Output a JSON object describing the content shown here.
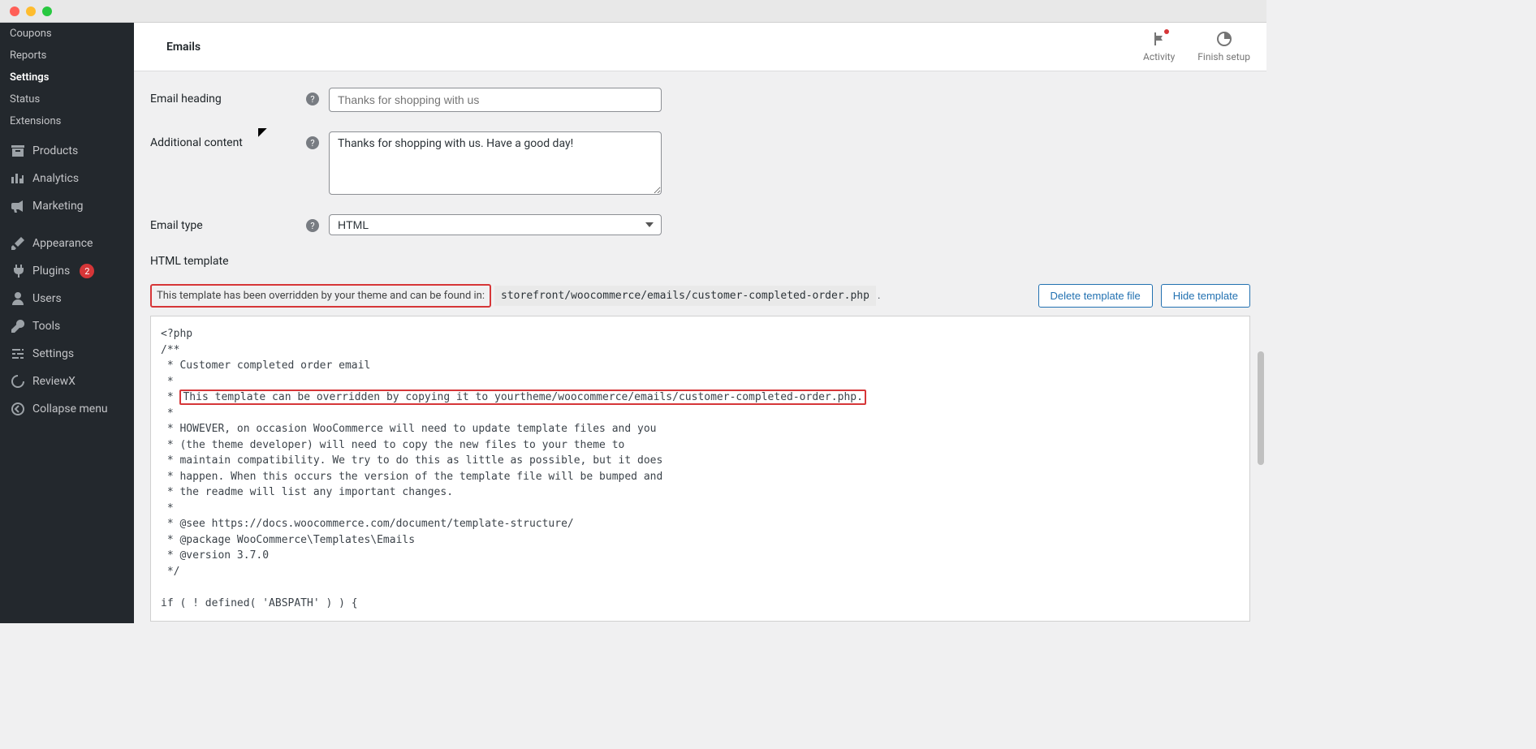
{
  "sidebar": {
    "sub_items": [
      "Coupons",
      "Reports",
      "Settings",
      "Status",
      "Extensions"
    ],
    "active_sub": "Settings",
    "items": [
      {
        "key": "products",
        "label": "Products",
        "icon": "archive"
      },
      {
        "key": "analytics",
        "label": "Analytics",
        "icon": "bars"
      },
      {
        "key": "marketing",
        "label": "Marketing",
        "icon": "megaphone"
      },
      {
        "key": "appearance",
        "label": "Appearance",
        "icon": "brush"
      },
      {
        "key": "plugins",
        "label": "Plugins",
        "icon": "plug",
        "badge": "2"
      },
      {
        "key": "users",
        "label": "Users",
        "icon": "user"
      },
      {
        "key": "tools",
        "label": "Tools",
        "icon": "wrench"
      },
      {
        "key": "settings",
        "label": "Settings",
        "icon": "sliders"
      },
      {
        "key": "reviewx",
        "label": "ReviewX",
        "icon": "spinner"
      },
      {
        "key": "collapse",
        "label": "Collapse menu",
        "icon": "collapse"
      }
    ]
  },
  "header": {
    "title": "Emails",
    "actions": {
      "activity": "Activity",
      "finish_setup": "Finish setup"
    }
  },
  "form": {
    "email_heading_label": "Email heading",
    "email_heading_placeholder": "Thanks for shopping with us",
    "additional_content_label": "Additional content",
    "additional_content_value": "Thanks for shopping with us. Have a good day!",
    "email_type_label": "Email type",
    "email_type_value": "HTML"
  },
  "template": {
    "heading": "HTML template",
    "override_msg": "This template has been overridden by your theme and can be found in:",
    "path": "storefront/woocommerce/emails/customer-completed-order.php",
    "delete_button": "Delete template file",
    "hide_button": "Hide template",
    "code_head": "<?php\n/**\n * Customer completed order email\n *\n *",
    "code_hl": "This template can be overridden by copying it to yourtheme/woocommerce/emails/customer-completed-order.php.",
    "code_tail": "\n *\n * HOWEVER, on occasion WooCommerce will need to update template files and you\n * (the theme developer) will need to copy the new files to your theme to\n * maintain compatibility. We try to do this as little as possible, but it does\n * happen. When this occurs the version of the template file will be bumped and\n * the readme will list any important changes.\n *\n * @see https://docs.woocommerce.com/document/template-structure/\n * @package WooCommerce\\Templates\\Emails\n * @version 3.7.0\n */\n\nif ( ! defined( 'ABSPATH' ) ) {"
  }
}
